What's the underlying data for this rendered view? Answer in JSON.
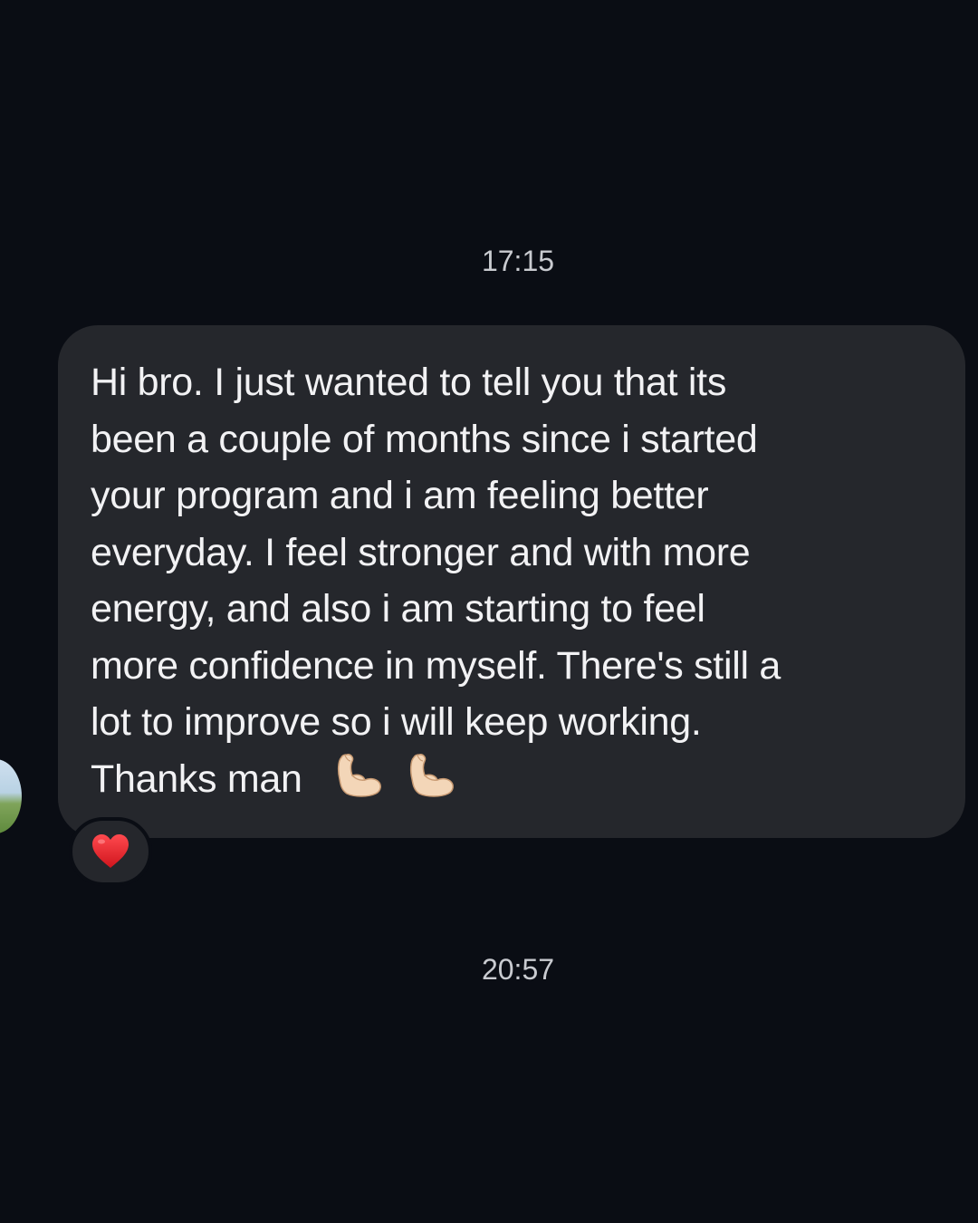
{
  "conversation": {
    "timestamps": {
      "top": "17:15",
      "bottom": "20:57"
    },
    "message": {
      "lines": [
        "Hi bro. I just wanted to tell you that its",
        "been a couple of months since i started",
        "your program and i am feeling better",
        "everyday. I feel stronger and with more",
        "energy, and also i am starting to feel",
        "more confidence in myself. There's still a",
        "lot to improve so i will keep working.",
        "Thanks man"
      ],
      "emojis": [
        "flexed-biceps-icon",
        "flexed-biceps-icon"
      ],
      "bubble_color": "#25272c"
    },
    "reaction": {
      "icon": "red-heart-icon",
      "color": "#e0242b"
    },
    "sender_avatar": {
      "icon": "avatar"
    }
  },
  "colors": {
    "background": "#0a0d14",
    "text": "#f2f2f4",
    "timestamp": "#c9cbd0"
  }
}
